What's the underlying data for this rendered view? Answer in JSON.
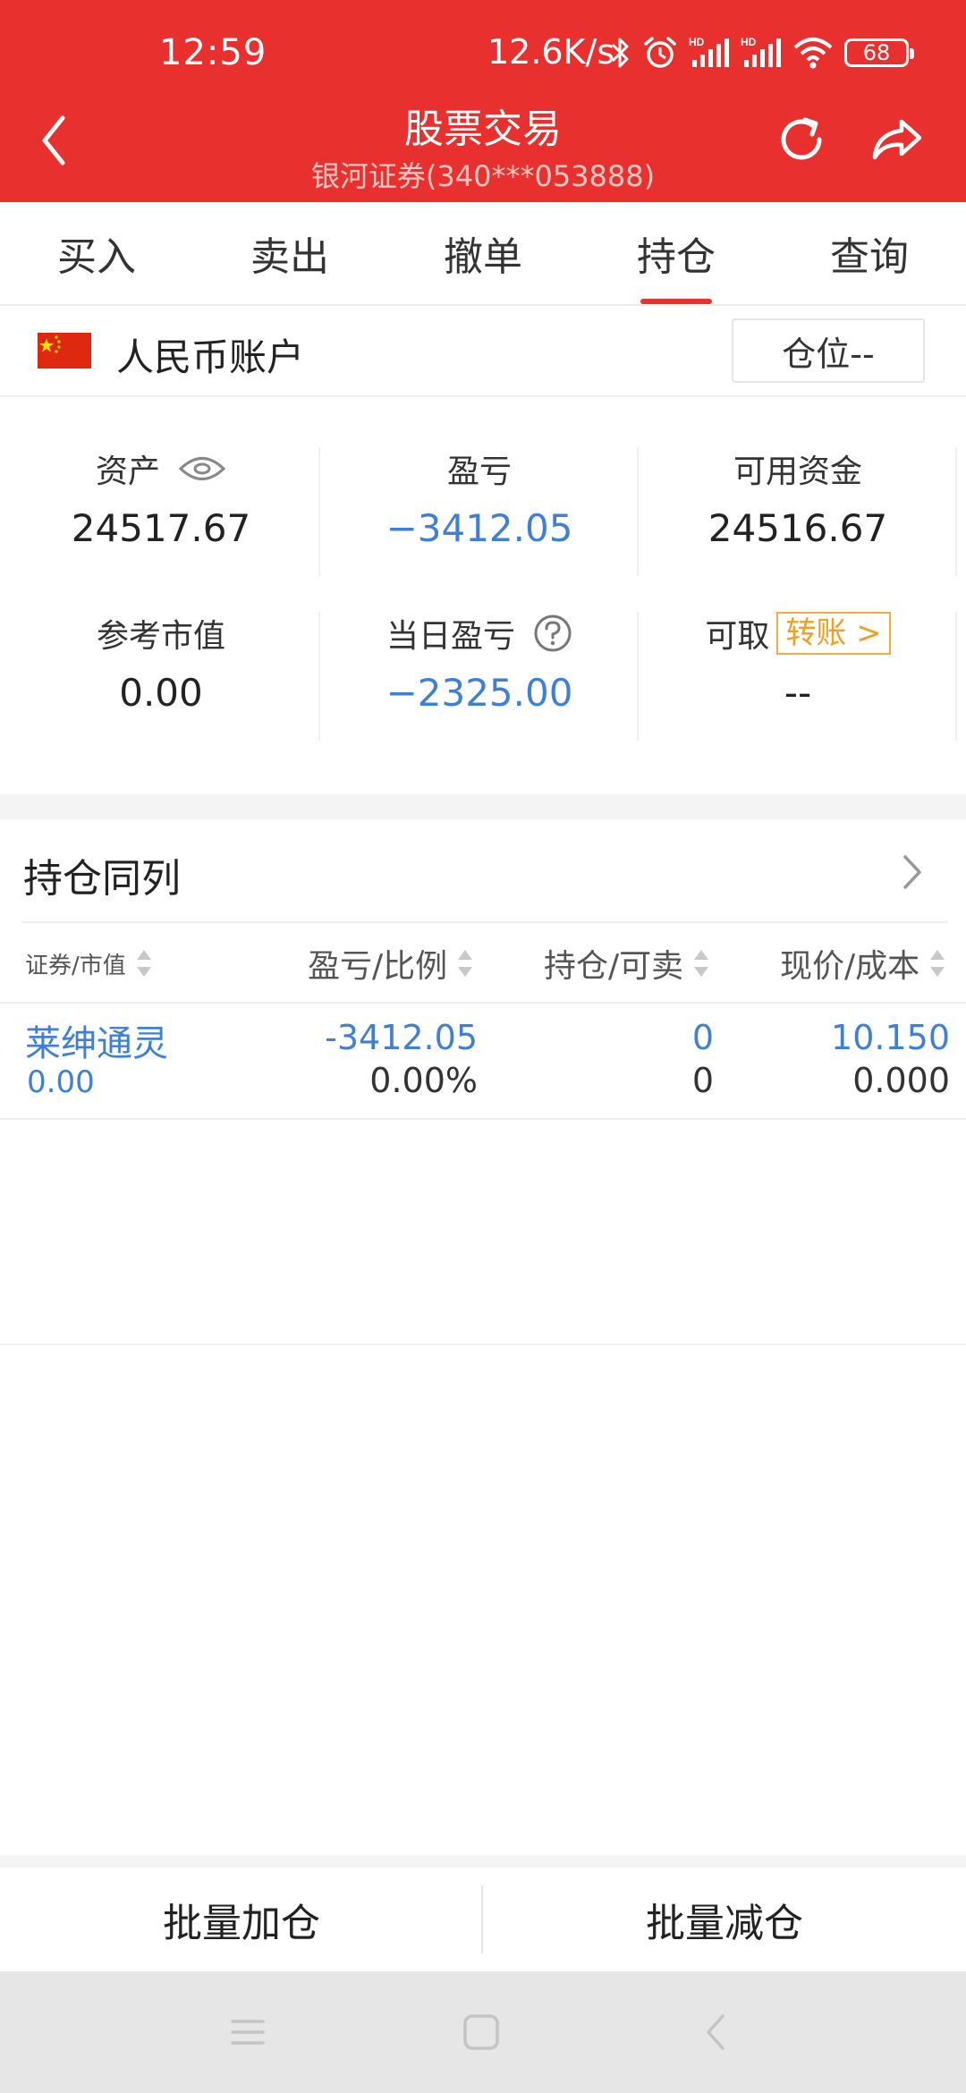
{
  "status_bar": {
    "time": "12:59",
    "net_speed": "12.6K/s",
    "battery": "68",
    "icons": [
      "bluetooth-icon",
      "alarm-icon",
      "signal-hd-icon",
      "signal-hd-icon",
      "wifi-icon",
      "battery-icon"
    ]
  },
  "header": {
    "title": "股票交易",
    "subtitle": "银河证券(340***053888)",
    "bg_color": "#e8312f"
  },
  "tabs": [
    {
      "label": "买入"
    },
    {
      "label": "卖出"
    },
    {
      "label": "撤单"
    },
    {
      "label": "持仓",
      "active": true
    },
    {
      "label": "查询"
    }
  ],
  "account": {
    "label": "人民币账户",
    "position_button": "仓位--"
  },
  "stats": {
    "assets": {
      "label": "资产",
      "value": "24517.67"
    },
    "pnl": {
      "label": "盈亏",
      "value": "−3412.05"
    },
    "available": {
      "label": "可用资金",
      "value": "24516.67"
    },
    "market_value": {
      "label": "参考市值",
      "value": "0.00"
    },
    "daily_pnl": {
      "label": "当日盈亏",
      "value": "−2325.00"
    },
    "withdrawable": {
      "label": "可取",
      "transfer_button": "转账 >",
      "value": "--"
    }
  },
  "holdings": {
    "title": "持仓同列",
    "columns": [
      "证券/市值",
      "盈亏/比例",
      "持仓/可卖",
      "现价/成本"
    ],
    "rows": [
      {
        "name": "莱绅通灵",
        "market_value": "0.00",
        "pnl": "-3412.05",
        "pnl_ratio": "0.00%",
        "position": "0",
        "sellable": "0",
        "price": "10.150",
        "cost": "0.000"
      }
    ]
  },
  "actions": {
    "add": "批量加仓",
    "reduce": "批量减仓"
  },
  "colors": {
    "accent": "#e8312f",
    "blue": "#3f7fd6",
    "transfer": "#f0a020"
  }
}
